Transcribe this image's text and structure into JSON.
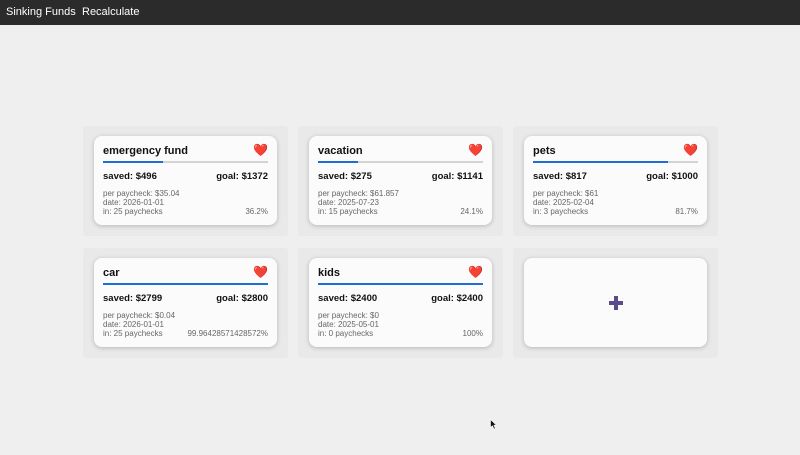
{
  "nav": {
    "brand": "Sinking Funds",
    "recalculate": "Recalculate"
  },
  "colors": {
    "navbar": "#2b2b2b",
    "progress": "#1f6ed6",
    "plus": "#5b4b8a",
    "heart": "#e02a2a"
  },
  "heart_glyph": "❤️",
  "funds": [
    {
      "name": "emergency fund",
      "saved": "saved: $496",
      "goal": "goal: $1372",
      "per_paycheck": "per paycheck: $35.04",
      "date": "date: 2026-01-01",
      "in": "in: 25 paychecks",
      "percent": "36.2%",
      "progress": 0.362
    },
    {
      "name": "vacation",
      "saved": "saved: $275",
      "goal": "goal: $1141",
      "per_paycheck": "per paycheck: $61.857",
      "date": "date: 2025-07-23",
      "in": "in: 15 paychecks",
      "percent": "24.1%",
      "progress": 0.241
    },
    {
      "name": "pets",
      "saved": "saved: $817",
      "goal": "goal: $1000",
      "per_paycheck": "per paycheck: $61",
      "date": "date: 2025-02-04",
      "in": "in: 3 paychecks",
      "percent": "81.7%",
      "progress": 0.817
    },
    {
      "name": "car",
      "saved": "saved: $2799",
      "goal": "goal: $2800",
      "per_paycheck": "per paycheck: $0.04",
      "date": "date: 2026-01-01",
      "in": "in: 25 paychecks",
      "percent": "99.96428571428572%",
      "progress": 0.9996
    },
    {
      "name": "kids",
      "saved": "saved: $2400",
      "goal": "goal: $2400",
      "per_paycheck": "per paycheck: $0",
      "date": "date: 2025-05-01",
      "in": "in: 0 paychecks",
      "percent": "100%",
      "progress": 1.0
    }
  ]
}
